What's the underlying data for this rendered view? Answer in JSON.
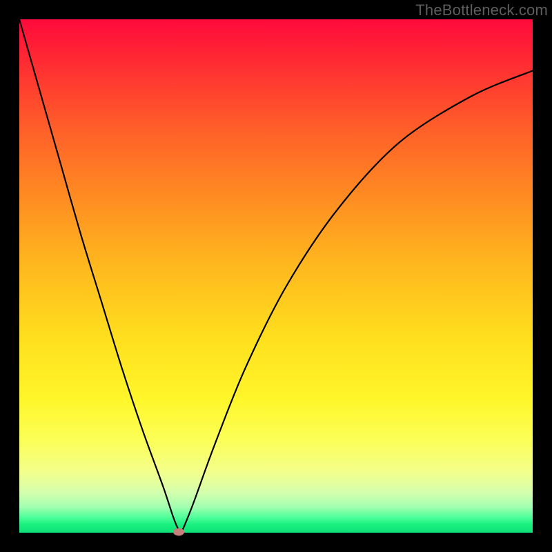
{
  "watermark": "TheBottleneck.com",
  "chart_data": {
    "type": "line",
    "title": "",
    "xlabel": "",
    "ylabel": "",
    "xlim": [
      0,
      100
    ],
    "ylim": [
      0,
      100
    ],
    "grid": false,
    "legend": false,
    "gradient_colors": {
      "top": "#ff0a3b",
      "middle": "#ffdf1e",
      "bottom": "#17f07e"
    },
    "series": [
      {
        "name": "curve",
        "color": "#000000",
        "x": [
          0,
          4,
          8,
          12,
          16,
          20,
          24,
          28,
          30,
          31,
          31.5,
          32,
          34,
          38,
          44,
          52,
          62,
          74,
          88,
          100
        ],
        "y": [
          100,
          86,
          72,
          58,
          45,
          32,
          20,
          9,
          3,
          0.6,
          0.2,
          1,
          6,
          17,
          32,
          48,
          63,
          76,
          85,
          90
        ]
      }
    ],
    "marker": {
      "x": 31.1,
      "y": 0.2,
      "color": "#c67f7a"
    }
  }
}
